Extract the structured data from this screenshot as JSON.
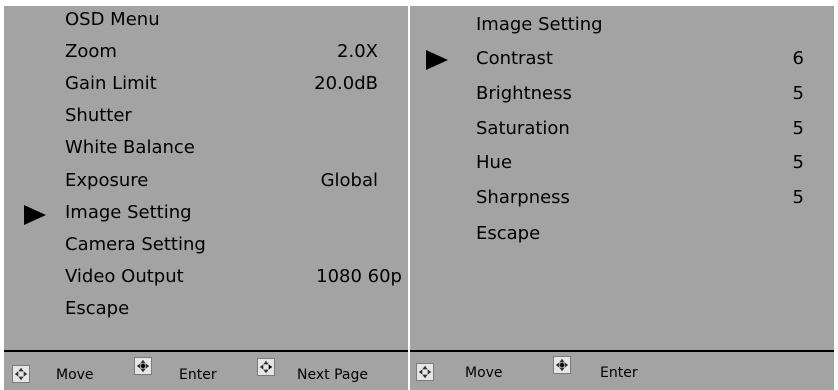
{
  "left_menu": {
    "title": "OSD Menu",
    "items": [
      {
        "label": "Zoom",
        "value": "2.0X"
      },
      {
        "label": "Gain Limit",
        "value": "20.0dB"
      },
      {
        "label": "Shutter",
        "value": ""
      },
      {
        "label": "White Balance",
        "value": ""
      },
      {
        "label": "Exposure",
        "value": "Global"
      },
      {
        "label": "Image Setting",
        "value": "",
        "selected": true
      },
      {
        "label": "Camera Setting",
        "value": ""
      },
      {
        "label": "Video Output",
        "value": "1080 60p"
      },
      {
        "label": "Escape",
        "value": ""
      }
    ],
    "footer": {
      "move": "Move",
      "enter": "Enter",
      "next_page": "Next Page"
    }
  },
  "right_menu": {
    "title": "Image Setting",
    "items": [
      {
        "label": "Contrast",
        "value": "6",
        "selected": true
      },
      {
        "label": "Brightness",
        "value": "5"
      },
      {
        "label": "Saturation",
        "value": "5"
      },
      {
        "label": "Hue",
        "value": "5"
      },
      {
        "label": "Sharpness",
        "value": "5"
      },
      {
        "label": "Escape",
        "value": ""
      }
    ],
    "footer": {
      "move": "Move",
      "enter": "Enter"
    }
  },
  "icons": {
    "cursor": "selection-arrow-icon",
    "move": "move-arrows-icon",
    "enter": "enter-arrows-icon",
    "next_page": "next-page-arrows-icon"
  },
  "colors": {
    "panel_bg": "#a3a3a3",
    "text": "#000000"
  }
}
